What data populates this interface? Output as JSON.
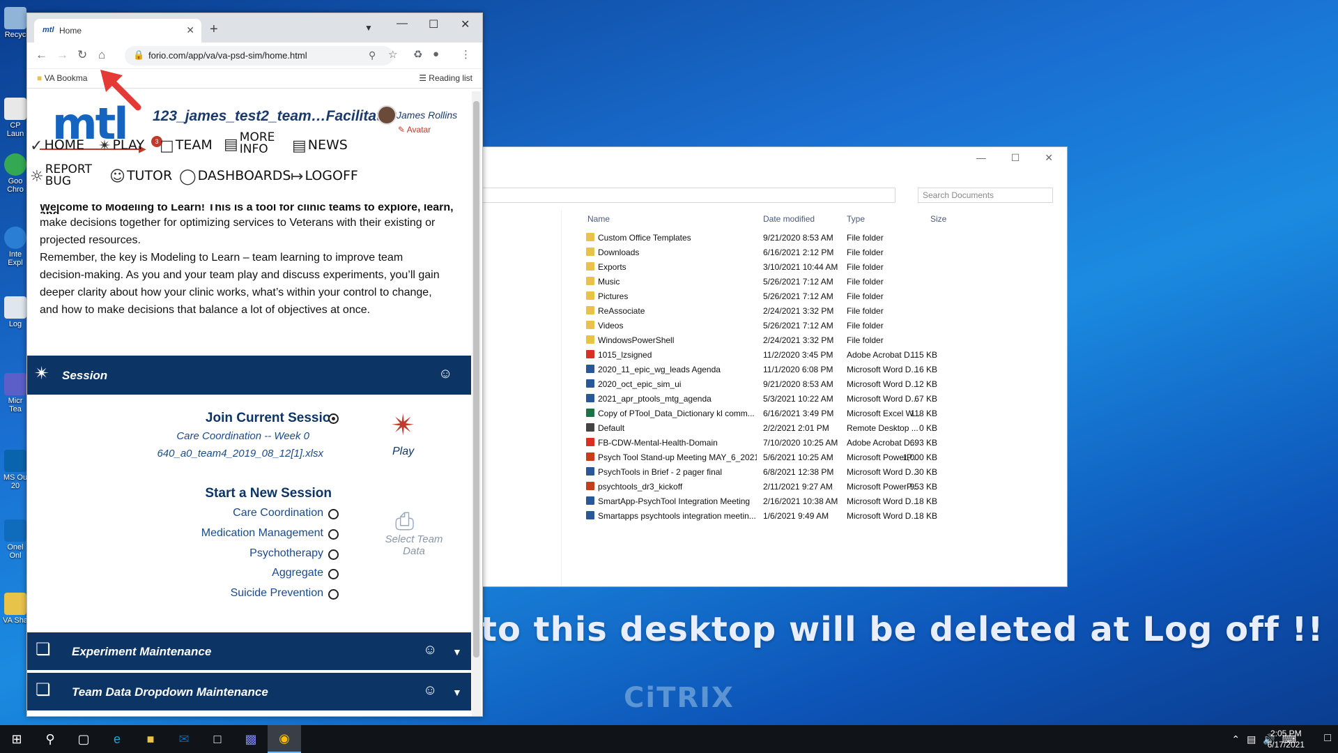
{
  "desktop": {
    "icon_labels": [
      "Recyc",
      "CP Laun",
      "Goo Chro",
      "Inte Expl",
      "Log",
      "Micr Tea",
      "MS Ou 20",
      "Onel Onl",
      "VA Sha"
    ],
    "banner": "to this desktop will be deleted at Log off !!",
    "watermark": "CiTRIX"
  },
  "browser": {
    "tab_title": "Home",
    "tab_favicon": "mtl",
    "url": "forio.com/app/va/va-psd-sim/home.html",
    "bookmark": "VA Bookma",
    "reading_list": "Reading list"
  },
  "page": {
    "logo": "mtl",
    "team_name": "123_james_test2_team…Facilitator",
    "user_name": "James Rollins",
    "avatar_link": "Avatar",
    "notification_count": "3",
    "menu": {
      "home": "HOME",
      "play": "PLAY",
      "team": "TEAM",
      "more_info_1": "MORE",
      "more_info_2": "INFO",
      "news": "NEWS",
      "report_1": "REPORT",
      "report_2": "BUG",
      "tutor": "TUTOR",
      "dashboards": "DASHBOARDS",
      "logoff": "LOGOFF"
    },
    "intro_line0": "Welcome to Modeling to Learn! This is a tool for clinic teams to explore, learn, and",
    "intro_line1": "make decisions together for optimizing services to Veterans with their existing or",
    "intro_line2": "projected resources.",
    "intro_line3": "Remember, the key is Modeling to Learn – team learning to improve team",
    "intro_line4": "decision-making. As you and your team play and discuss experiments, you’ll gain",
    "intro_line5": "deeper clarity about how your clinic works, what’s within your control to change,",
    "intro_line6": "and how to make decisions that balance a lot of objectives at once.",
    "session_bar": "Session",
    "join_title": "Join Current Session",
    "join_sub": "Care Coordination -- Week 0",
    "join_file": "640_a0_team4_2019_08_12[1].xlsx",
    "play_label": "Play",
    "new_title": "Start a New Session",
    "options": [
      "Care Coordination",
      "Medication Management",
      "Psychotherapy",
      "Aggregate",
      "Suicide Prevention"
    ],
    "select_team_data_1": "Select Team",
    "select_team_data_2": "Data",
    "experiment_bar": "Experiment Maintenance",
    "team_data_bar": "Team Data Dropdown Maintenance"
  },
  "explorer": {
    "search_placeholder": "Search Documents",
    "columns": [
      "Name",
      "Date modified",
      "Type",
      "Size"
    ],
    "rows": [
      [
        "Custom Office Templates",
        "9/21/2020 8:53 AM",
        "File folder",
        ""
      ],
      [
        "Downloads",
        "6/16/2021 2:12 PM",
        "File folder",
        ""
      ],
      [
        "Exports",
        "3/10/2021 10:44 AM",
        "File folder",
        ""
      ],
      [
        "Music",
        "5/26/2021 7:12 AM",
        "File folder",
        ""
      ],
      [
        "Pictures",
        "5/26/2021 7:12 AM",
        "File folder",
        ""
      ],
      [
        "ReAssociate",
        "2/24/2021 3:32 PM",
        "File folder",
        ""
      ],
      [
        "Videos",
        "5/26/2021 7:12 AM",
        "File folder",
        ""
      ],
      [
        "WindowsPowerShell",
        "2/24/2021 3:32 PM",
        "File folder",
        ""
      ],
      [
        "1015_lzsigned",
        "11/2/2020 3:45 PM",
        "Adobe Acrobat D...",
        "115 KB"
      ],
      [
        "2020_11_epic_wg_leads Agenda",
        "11/1/2020 6:08 PM",
        "Microsoft Word D...",
        "16 KB"
      ],
      [
        "2020_oct_epic_sim_ui",
        "9/21/2020 8:53 AM",
        "Microsoft Word D...",
        "12 KB"
      ],
      [
        "2021_apr_ptools_mtg_agenda",
        "5/3/2021 10:22 AM",
        "Microsoft Word D...",
        "67 KB"
      ],
      [
        "Copy of PTool_Data_Dictionary kl comm...",
        "6/16/2021 3:49 PM",
        "Microsoft Excel W...",
        "118 KB"
      ],
      [
        "Default",
        "2/2/2021 2:01 PM",
        "Remote Desktop ...",
        "0 KB"
      ],
      [
        "FB-CDW-Mental-Health-Domain",
        "7/10/2020 10:25 AM",
        "Adobe Acrobat D...",
        "693 KB"
      ],
      [
        "Psych Tool Stand-up Meeting MAY_6_2021",
        "5/6/2021 10:25 AM",
        "Microsoft PowerP...",
        "1,000 KB"
      ],
      [
        "PsychTools in Brief - 2 pager final",
        "6/8/2021 12:38 PM",
        "Microsoft Word D...",
        "30 KB"
      ],
      [
        "psychtools_dr3_kickoff",
        "2/11/2021 9:27 AM",
        "Microsoft PowerP...",
        "953 KB"
      ],
      [
        "SmartApp-PsychTool Integration Meeting",
        "2/16/2021 10:38 AM",
        "Microsoft Word D...",
        "18 KB"
      ],
      [
        "Smartapps psychtools integration meetin...",
        "1/6/2021 9:49 AM",
        "Microsoft Word D...",
        "18 KB"
      ]
    ]
  },
  "taskbar": {
    "time": "2:05 PM",
    "date": "6/17/2021"
  },
  "colors": {
    "nav_bar": "#0c3566",
    "accent_red": "#c0392b",
    "logo_blue": "#1565c0"
  }
}
